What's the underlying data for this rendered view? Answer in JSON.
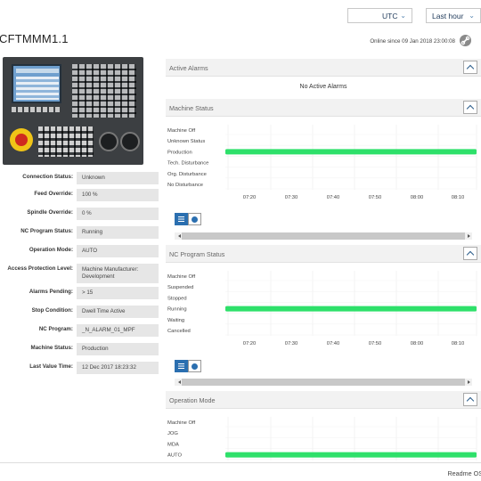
{
  "header": {
    "timezone": "UTC",
    "range": "Last hour",
    "title": "CFTMMM1.1",
    "online_since": "Online since 09 Jan 2018 23:00:08"
  },
  "fields": [
    {
      "label": "Connection Status:",
      "value": "Unknown"
    },
    {
      "label": "Feed Override:",
      "value": "100 %"
    },
    {
      "label": "Spindle Override:",
      "value": "0 %"
    },
    {
      "label": "NC Program Status:",
      "value": "Running"
    },
    {
      "label": "Operation Mode:",
      "value": "AUTO"
    },
    {
      "label": "Access Protection Level:",
      "value": "Machine Manufacturer: Development"
    },
    {
      "label": "Alarms Pending:",
      "value": "> 15"
    },
    {
      "label": "Stop Condition:",
      "value": "Dwell Time Active"
    },
    {
      "label": "NC Program:",
      "value": "_N_ALARM_01_MPF"
    },
    {
      "label": "Machine Status:",
      "value": "Production"
    },
    {
      "label": "Last Value Time:",
      "value": "12 Dec 2017 18:23:32"
    }
  ],
  "panels": {
    "active_alarms": {
      "title": "Active Alarms",
      "empty_text": "No Active Alarms"
    },
    "machine_status": {
      "title": "Machine Status"
    },
    "nc_program_status": {
      "title": "NC Program Status"
    },
    "operation_mode": {
      "title": "Operation Mode"
    }
  },
  "chart_data": [
    {
      "type": "timeline",
      "categories": [
        "Machine Off",
        "Unknown Status",
        "Production",
        "Tech. Disturbance",
        "Org. Disturbance",
        "No Disturbance"
      ],
      "x_ticks": [
        "07:20",
        "07:30",
        "07:40",
        "07:50",
        "08:00",
        "08:10"
      ],
      "active_state": "Production",
      "active_range": [
        0.0,
        1.0
      ],
      "color": "#2ee06a"
    },
    {
      "type": "timeline",
      "categories": [
        "Machine Off",
        "Suspended",
        "Stopped",
        "Running",
        "Waiting",
        "Cancelled"
      ],
      "x_ticks": [
        "07:20",
        "07:30",
        "07:40",
        "07:50",
        "08:00",
        "08:10"
      ],
      "active_state": "Running",
      "active_range": [
        0.0,
        1.0
      ],
      "color": "#2ee06a"
    },
    {
      "type": "timeline",
      "categories": [
        "Machine Off",
        "JOG",
        "MDA",
        "AUTO"
      ],
      "x_ticks": [],
      "active_state": "AUTO",
      "active_range": [
        0.0,
        1.0
      ],
      "color": "#2ee06a"
    }
  ],
  "footer": {
    "readme": "Readme OS"
  }
}
